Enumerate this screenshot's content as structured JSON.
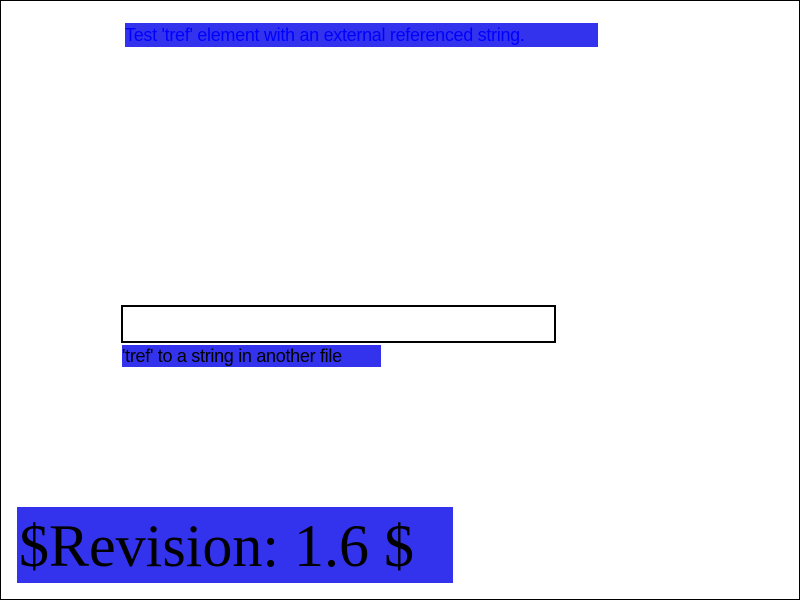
{
  "test_title": "Test 'tref' element with an external referenced string.",
  "tref_label": "'tref' to a string in another file",
  "revision": "$Revision: 1.6 $",
  "colors": {
    "highlight": "#3333ee",
    "title_text": "#0000ff",
    "body_text": "#000000",
    "background": "#ffffff"
  }
}
